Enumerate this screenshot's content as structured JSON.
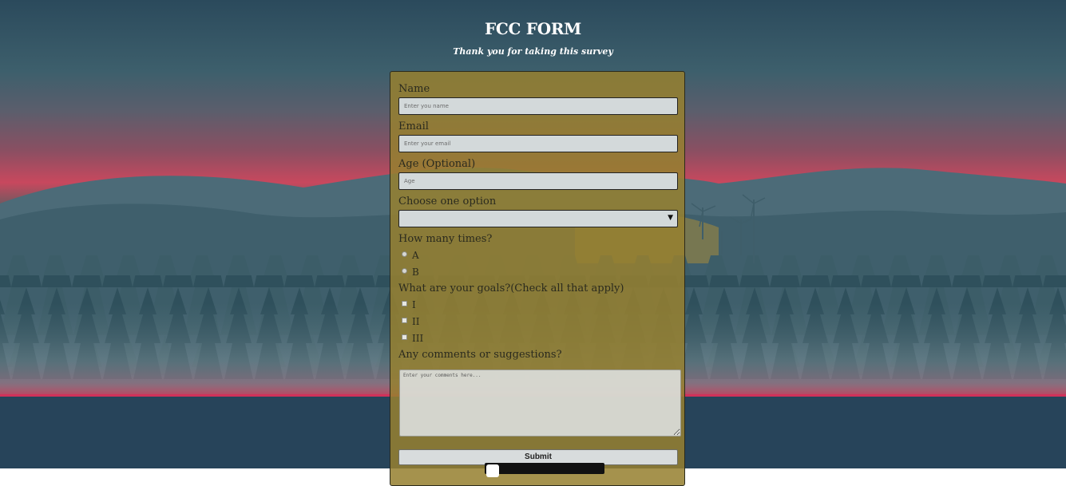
{
  "header": {
    "title": "FCC FORM",
    "subtitle": "Thank you for taking this survey"
  },
  "form": {
    "name": {
      "label": "Name",
      "placeholder": "Enter you name"
    },
    "email": {
      "label": "Email",
      "placeholder": "Enter your email"
    },
    "age": {
      "label": "Age (Optional)",
      "placeholder": "Age"
    },
    "dropdown": {
      "label": "Choose one option",
      "selected": ""
    },
    "times": {
      "label": "How many times?",
      "options": [
        "A",
        "B"
      ]
    },
    "goals": {
      "label": "What are your goals?(Check all that apply)",
      "options": [
        "I",
        "II",
        "III"
      ]
    },
    "comments": {
      "label": "Any comments or suggestions?",
      "placeholder": "Enter your comments here..."
    },
    "submit_label": "Submit"
  },
  "colors": {
    "sky_top": "#2b4a5c",
    "horizon": "#c8485e",
    "water": "#27445a",
    "form_bg": "#967f30"
  },
  "icons": {
    "dropdown_arrow": "chevron-down-icon"
  }
}
